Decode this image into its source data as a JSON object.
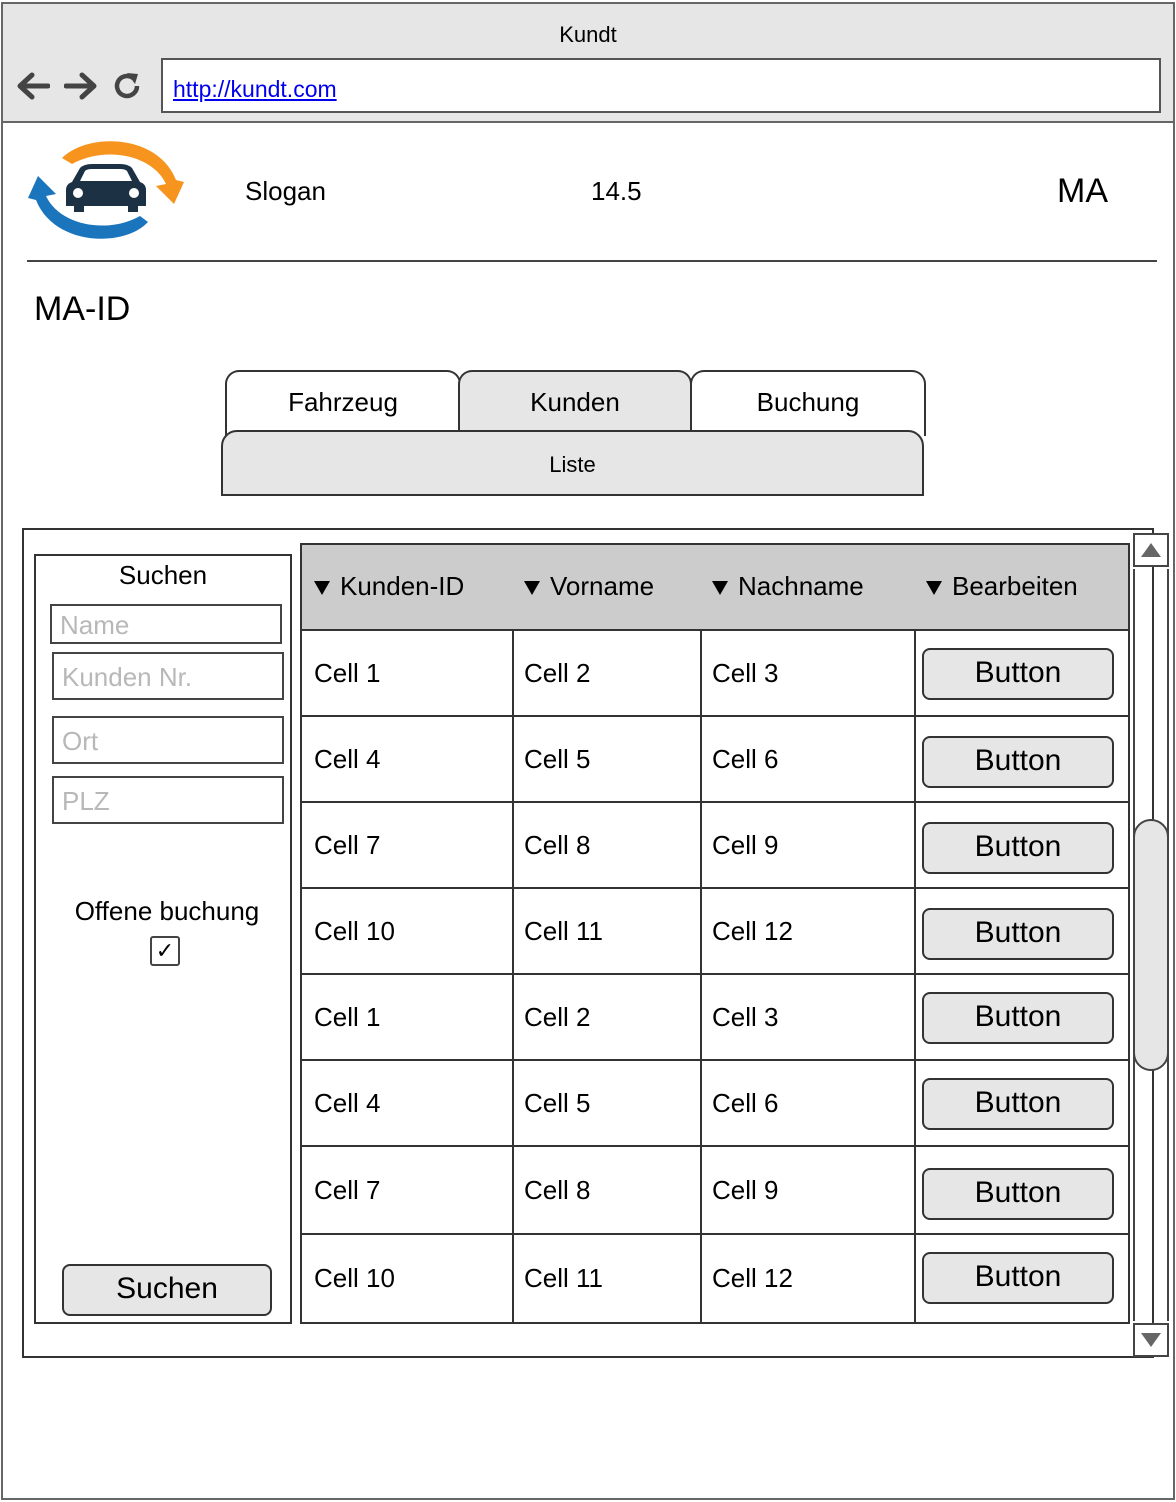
{
  "browser": {
    "title": "Kundt",
    "url": "http://kundt.com"
  },
  "header": {
    "slogan": "Slogan",
    "version": "14.5",
    "user": "MA",
    "employee_id_label": "MA-ID"
  },
  "tabs": [
    {
      "label": "Fahrzeug",
      "active": false
    },
    {
      "label": "Kunden",
      "active": true
    },
    {
      "label": "Buchung",
      "active": false
    }
  ],
  "subtab": {
    "label": "Liste"
  },
  "search": {
    "title": "Suchen",
    "fields": [
      {
        "placeholder": "Name"
      },
      {
        "placeholder": "Kunden Nr."
      },
      {
        "placeholder": "Ort"
      },
      {
        "placeholder": "PLZ"
      }
    ],
    "open_booking_label": "Offene buchung",
    "open_booking_checked": true,
    "check_mark": "✓",
    "button_label": "Suchen"
  },
  "table": {
    "columns": [
      "Kunden-ID",
      "Vorname",
      "Nachname",
      "Bearbeiten"
    ],
    "rows": [
      [
        "Cell 1",
        "Cell 2",
        "Cell 3",
        "Button"
      ],
      [
        "Cell 4",
        "Cell 5",
        "Cell 6",
        "Button"
      ],
      [
        "Cell 7",
        "Cell 8",
        "Cell 9",
        "Button"
      ],
      [
        "Cell 10",
        "Cell 11",
        "Cell 12",
        "Button"
      ],
      [
        "Cell 1",
        "Cell 2",
        "Cell 3",
        "Button"
      ],
      [
        "Cell 4",
        "Cell 5",
        "Cell 6",
        "Button"
      ],
      [
        "Cell 7",
        "Cell 8",
        "Cell 9",
        "Button"
      ],
      [
        "Cell 10",
        "Cell 11",
        "Cell 12",
        "Button"
      ]
    ]
  },
  "colors": {
    "chrome_bg": "#e6e6e6",
    "header_cell_bg": "#cccccc",
    "logo_orange": "#f7941d",
    "logo_blue": "#1b75bc",
    "logo_car": "#1c3144"
  }
}
